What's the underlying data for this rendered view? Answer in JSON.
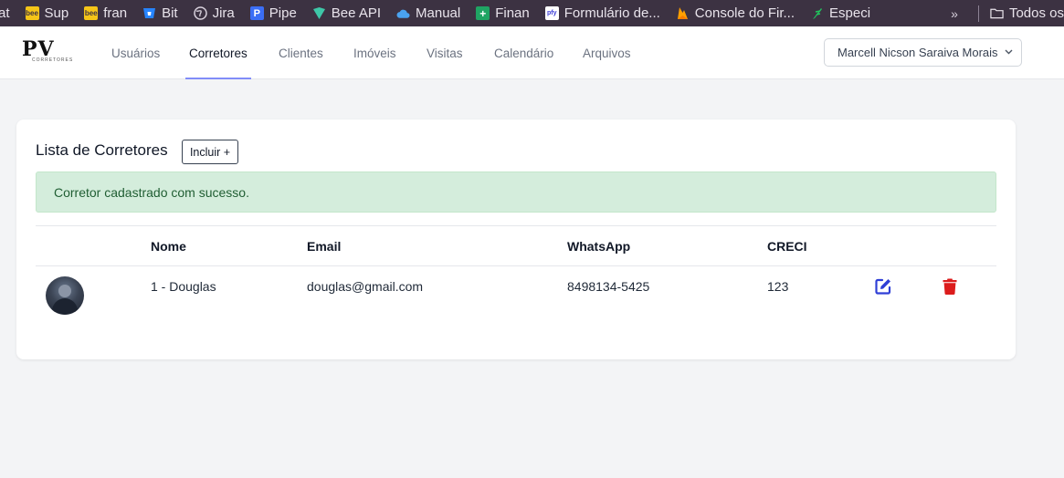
{
  "bookmarks": [
    {
      "label": "at",
      "icon": "bee-icon",
      "color": ""
    },
    {
      "label": "Sup",
      "icon": "bee-icon",
      "color": "#f5c518"
    },
    {
      "label": "fran",
      "icon": "bee-icon",
      "color": "#f5c518"
    },
    {
      "label": "Bit",
      "icon": "bitbucket-icon",
      "color": "#2684ff"
    },
    {
      "label": "Jira",
      "icon": "globe-icon",
      "color": "#d8d1dc"
    },
    {
      "label": "Pipe",
      "icon": "pipefy-icon",
      "color": "#3b6ef5"
    },
    {
      "label": "Bee API",
      "icon": "beeapi-icon",
      "color": "#3ec7a8"
    },
    {
      "label": "Manual",
      "icon": "cloud-icon",
      "color": "#4aa3f0"
    },
    {
      "label": "Finan",
      "icon": "sheets-icon",
      "color": "#1fa463"
    },
    {
      "label": "Formulário de...",
      "icon": "pfy-icon",
      "color": "#ffffff"
    },
    {
      "label": "Console do Fir...",
      "icon": "firebase-icon",
      "color": "#ffa000"
    },
    {
      "label": "Especi",
      "icon": "feather-icon",
      "color": "#21c55d"
    }
  ],
  "bookmarks_overflow": "»",
  "other_bookmarks": "Todos os",
  "nav": {
    "logo_text": "PV",
    "logo_sub": "CORRETORES",
    "items": [
      "Usuários",
      "Corretores",
      "Clientes",
      "Imóveis",
      "Visitas",
      "Calendário",
      "Arquivos"
    ],
    "active": "Corretores",
    "user_name": "Marcell Nicson Saraiva Morais",
    "user_caret": "⌄"
  },
  "page": {
    "title": "Lista de Corretores",
    "add_button": "Incluir +",
    "alert": "Corretor cadastrado com sucesso."
  },
  "table": {
    "headers": [
      "Nome",
      "Email",
      "WhatsApp",
      "CRECI"
    ],
    "rows": [
      {
        "name": "1 - Douglas",
        "email": "douglas@gmail.com",
        "whatsapp": "8498134-5425",
        "creci": "123"
      }
    ]
  },
  "colors": {
    "edit": "#2f3fd6",
    "delete": "#dc1c1c",
    "alert_bg": "#d4eddc",
    "tab_underline": "#818cf8"
  }
}
